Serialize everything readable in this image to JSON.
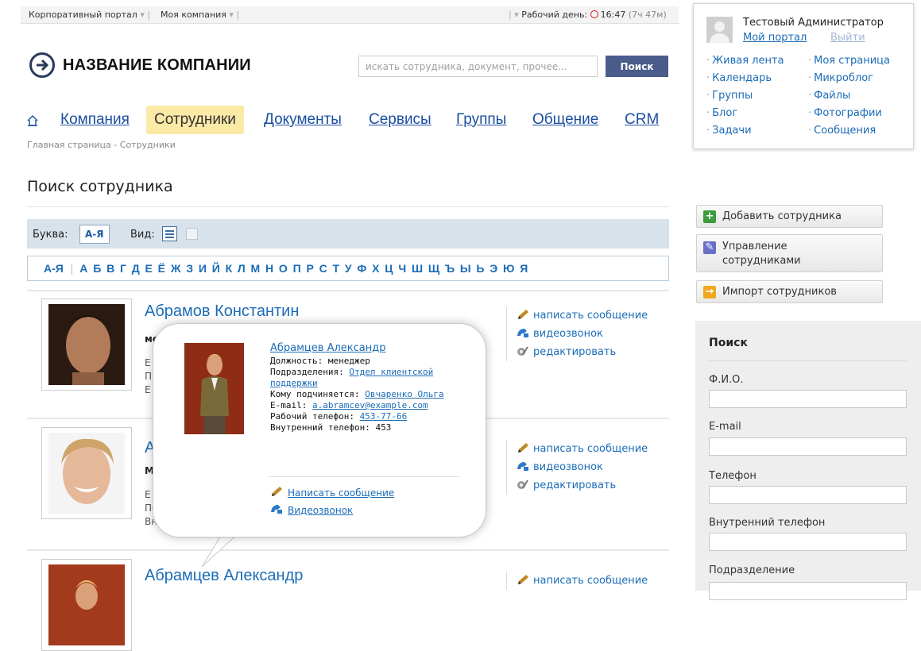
{
  "topbar": {
    "portal": "Корпоративный портал",
    "company": "Моя компания",
    "workday_label": "Рабочий день:",
    "time": "16:47",
    "duration": "(7ч 47м)"
  },
  "header": {
    "company_name": "НАЗВАНИЕ КОМПАНИИ",
    "search_placeholder": "искать сотрудника, документ, прочее...",
    "search_button": "Поиск"
  },
  "nav": {
    "items": [
      "Компания",
      "Сотрудники",
      "Документы",
      "Сервисы",
      "Группы",
      "Общение",
      "CRM"
    ],
    "active": "Сотрудники"
  },
  "breadcrumb": {
    "home": "Главная страница",
    "sep": "-",
    "current": "Сотрудники"
  },
  "page": {
    "title": "Поиск сотрудника"
  },
  "filter": {
    "letter_label": "Буква:",
    "letter_value": "А-Я",
    "view_label": "Вид:"
  },
  "alphabet": {
    "all": "А-Я",
    "letters": [
      "А",
      "Б",
      "В",
      "Г",
      "Д",
      "Е",
      "Ё",
      "Ж",
      "З",
      "И",
      "Й",
      "К",
      "Л",
      "М",
      "Н",
      "О",
      "П",
      "Р",
      "С",
      "Т",
      "У",
      "Ф",
      "Х",
      "Ц",
      "Ч",
      "Ш",
      "Щ",
      "Ъ",
      "Ы",
      "Ь",
      "Э",
      "Ю",
      "Я"
    ]
  },
  "employees": [
    {
      "name": "Абрамов Константин",
      "lines": [
        "ме",
        "Е",
        "П",
        "Е"
      ]
    },
    {
      "name": "А",
      "lines": [
        "М",
        "Е",
        "По",
        "Внутренн"
      ]
    },
    {
      "name": "Абрамцев Александр",
      "lines": []
    }
  ],
  "actions": {
    "message": "написать сообщение",
    "video": "видеозвонок",
    "edit": "редактировать"
  },
  "popup": {
    "name": "Абрамцев Александр",
    "position_label": "Должность:",
    "position": "менеджер",
    "department_label": "Подразделения:",
    "department": "Отдел клиентской поддержки",
    "manager_label": "Кому подчиняется:",
    "manager": "Овчаренко Ольга",
    "email_label": "E-mail:",
    "email": "a.abramcev@example.com",
    "work_phone_label": "Рабочий телефон:",
    "work_phone": "453-77-66",
    "internal_phone_label": "Внутренний телефон:",
    "internal_phone": "453",
    "write_message": "Написать сообщение",
    "video_call": "Видеозвонок"
  },
  "user_panel": {
    "name": "Тестовый Администратор",
    "my_portal": "Мой портал",
    "logout": "Выйти",
    "links_left": [
      "Живая лента",
      "Календарь",
      "Группы",
      "Блог",
      "Задачи"
    ],
    "links_right": [
      "Моя страница",
      "Микроблог",
      "Файлы",
      "Фотографии",
      "Сообщения"
    ]
  },
  "side_buttons": {
    "add": "Добавить сотрудника",
    "manage_1": "Управление",
    "manage_2": "сотрудниками",
    "import": "Импорт сотрудников"
  },
  "side_search": {
    "title": "Поиск",
    "fio": "Ф.И.О.",
    "email": "E-mail",
    "phone": "Телефон",
    "internal_phone": "Внутренний телефон",
    "department": "Подразделение"
  },
  "colors": {
    "link": "#1b6cb7",
    "active_tab": "#fbe9a6",
    "search_button": "#4a5d8a",
    "filter_bar": "#d8e2ea"
  }
}
